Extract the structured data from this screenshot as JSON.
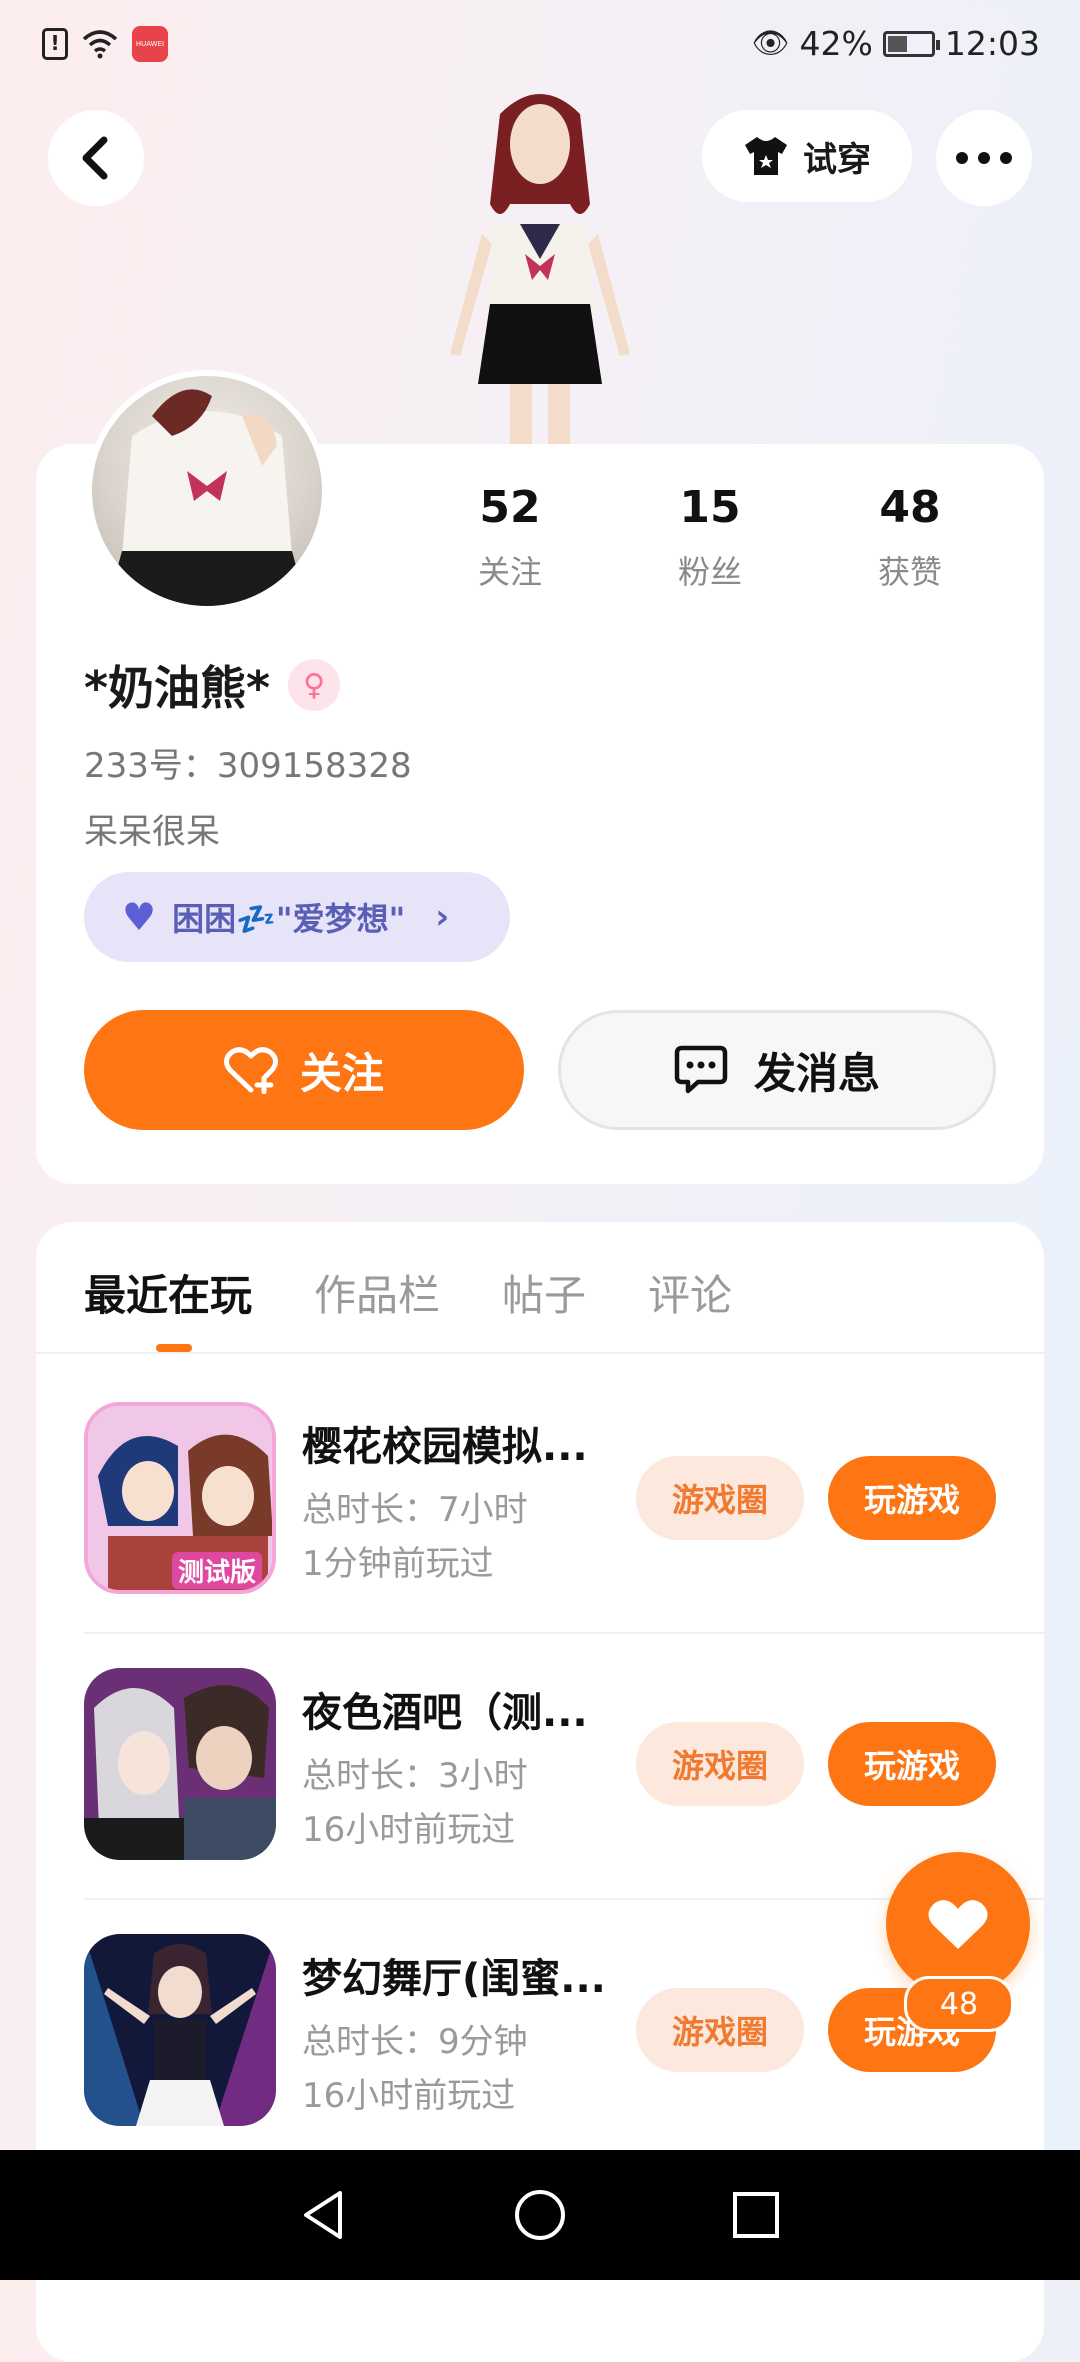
{
  "status_bar": {
    "battery": "42%",
    "time": "12:03",
    "app_badge": "HUAWEI"
  },
  "header": {
    "tryon_label": "试穿"
  },
  "profile": {
    "stats": [
      {
        "num": "52",
        "label": "关注"
      },
      {
        "num": "15",
        "label": "粉丝"
      },
      {
        "num": "48",
        "label": "获赞"
      }
    ],
    "nickname": "*奶油熊*",
    "gender_symbol": "♀",
    "uid": "233号：309158328",
    "bio": "呆呆很呆",
    "club": "困困💤\"爱梦想\"",
    "follow_label": "关注",
    "message_label": "发消息"
  },
  "tabs": [
    "最近在玩",
    "作品栏",
    "帖子",
    "评论"
  ],
  "games": [
    {
      "title": "樱花校园模拟...",
      "duration": "总时长：7小时",
      "last_played": "1分钟前玩过",
      "circle_label": "游戏圈",
      "play_label": "玩游戏",
      "icon_text": "测试版"
    },
    {
      "title": "夜色酒吧（测...",
      "duration": "总时长：3小时",
      "last_played": "16小时前玩过",
      "circle_label": "游戏圈",
      "play_label": "玩游戏",
      "icon_text": ""
    },
    {
      "title": "梦幻舞厅(闺蜜...",
      "duration": "总时长：9分钟",
      "last_played": "16小时前玩过",
      "circle_label": "游戏圈",
      "play_label": "玩游戏",
      "icon_text": ""
    }
  ],
  "fab": {
    "count": "48"
  },
  "colors": {
    "accent": "#fd7613",
    "club_bg": "#e7e3f9",
    "circle_btn_bg": "#fde8de"
  }
}
